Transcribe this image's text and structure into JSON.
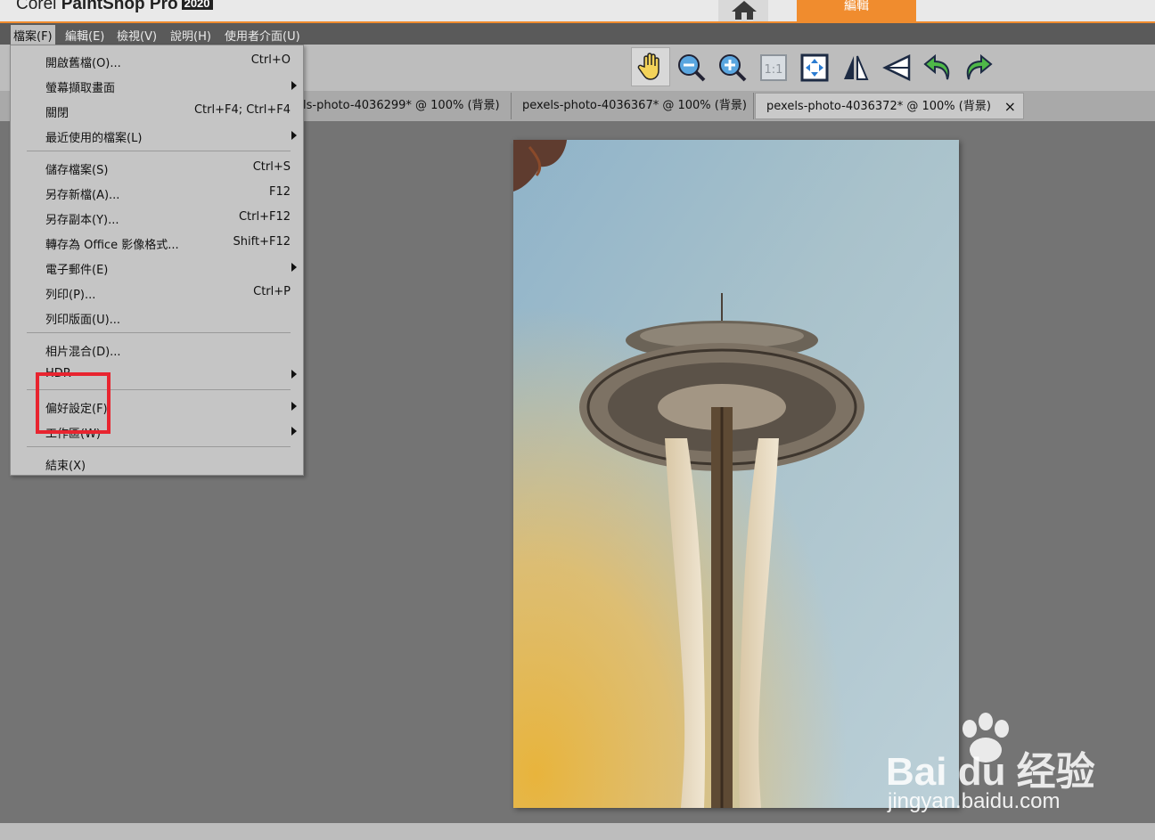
{
  "app": {
    "brand_prefix": "Corel",
    "brand_name": "PaintShop Pro",
    "brand_year": "2020",
    "edit_tab_label": "編輯"
  },
  "menubar": [
    "檔案(F)",
    "編輯(E)",
    "檢視(V)",
    "說明(H)",
    "使用者介面(U)"
  ],
  "tabs": [
    {
      "label": "ls-photo-4036299* @ 100% (背景)"
    },
    {
      "label": "pexels-photo-4036367* @ 100% (背景)"
    },
    {
      "label": "pexels-photo-4036372* @ 100% (背景)",
      "close": "×"
    }
  ],
  "file_menu": [
    {
      "label": "開啟舊檔(O)...",
      "shortcut": "Ctrl+O"
    },
    {
      "label": "螢幕擷取畫面",
      "shortcut": ""
    },
    {
      "label": "關閉",
      "shortcut": "Ctrl+F4; Ctrl+F4"
    },
    {
      "label": "最近使用的檔案(L)",
      "shortcut": ""
    },
    {
      "label": "儲存檔案(S)",
      "shortcut": "Ctrl+S"
    },
    {
      "label": "另存新檔(A)...",
      "shortcut": "F12"
    },
    {
      "label": "另存副本(Y)...",
      "shortcut": "Ctrl+F12"
    },
    {
      "label": "轉存為 Office 影像格式...",
      "shortcut": "Shift+F12"
    },
    {
      "label": "電子郵件(E)",
      "shortcut": ""
    },
    {
      "label": "列印(P)...",
      "shortcut": "Ctrl+P"
    },
    {
      "label": "列印版面(U)...",
      "shortcut": ""
    },
    {
      "label": "相片混合(D)...",
      "shortcut": ""
    },
    {
      "label": "HDR",
      "shortcut": ""
    },
    {
      "label": "偏好設定(F)",
      "shortcut": ""
    },
    {
      "label": "工作區(W)",
      "shortcut": ""
    },
    {
      "label": "結束(X)",
      "shortcut": ""
    }
  ],
  "toolbar_icons": [
    "pan-hand-icon",
    "zoom-out-icon",
    "zoom-in-icon",
    "actual-size-icon",
    "fit-window-icon",
    "flip-icon",
    "mirror-icon",
    "rotate-left-icon",
    "rotate-right-icon"
  ],
  "watermark": {
    "line1": "Bai du 经验",
    "line2": "jingyan.baidu.com"
  },
  "colors": {
    "accent": "#f08c2e",
    "highlight": "#e8242f",
    "menu_bg": "#c5c5c5",
    "workspace": "#747474"
  }
}
